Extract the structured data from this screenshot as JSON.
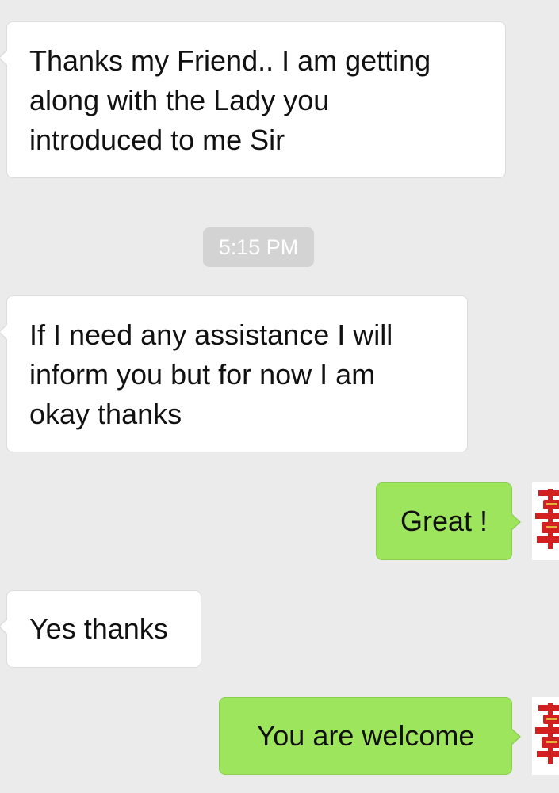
{
  "messages": [
    {
      "direction": "incoming",
      "text": "Thanks my Friend.. I am getting\nalong with the Lady you\nintroduced to me Sir"
    },
    {
      "direction": "incoming",
      "text": "If I need any  assistance I will\ninform you but for now I am\nokay thanks"
    },
    {
      "direction": "outgoing",
      "text": "Great !"
    },
    {
      "direction": "incoming",
      "text": "Yes thanks"
    },
    {
      "direction": "outgoing",
      "text": "You are welcome"
    }
  ],
  "timestamp": "5:15 PM",
  "avatar_icon": "double-happiness-icon",
  "colors": {
    "background": "#ebebeb",
    "incoming_bubble": "#ffffff",
    "outgoing_bubble": "#9de55c",
    "timestamp_badge": "#d3d3d3",
    "avatar_red": "#d21f1f"
  }
}
